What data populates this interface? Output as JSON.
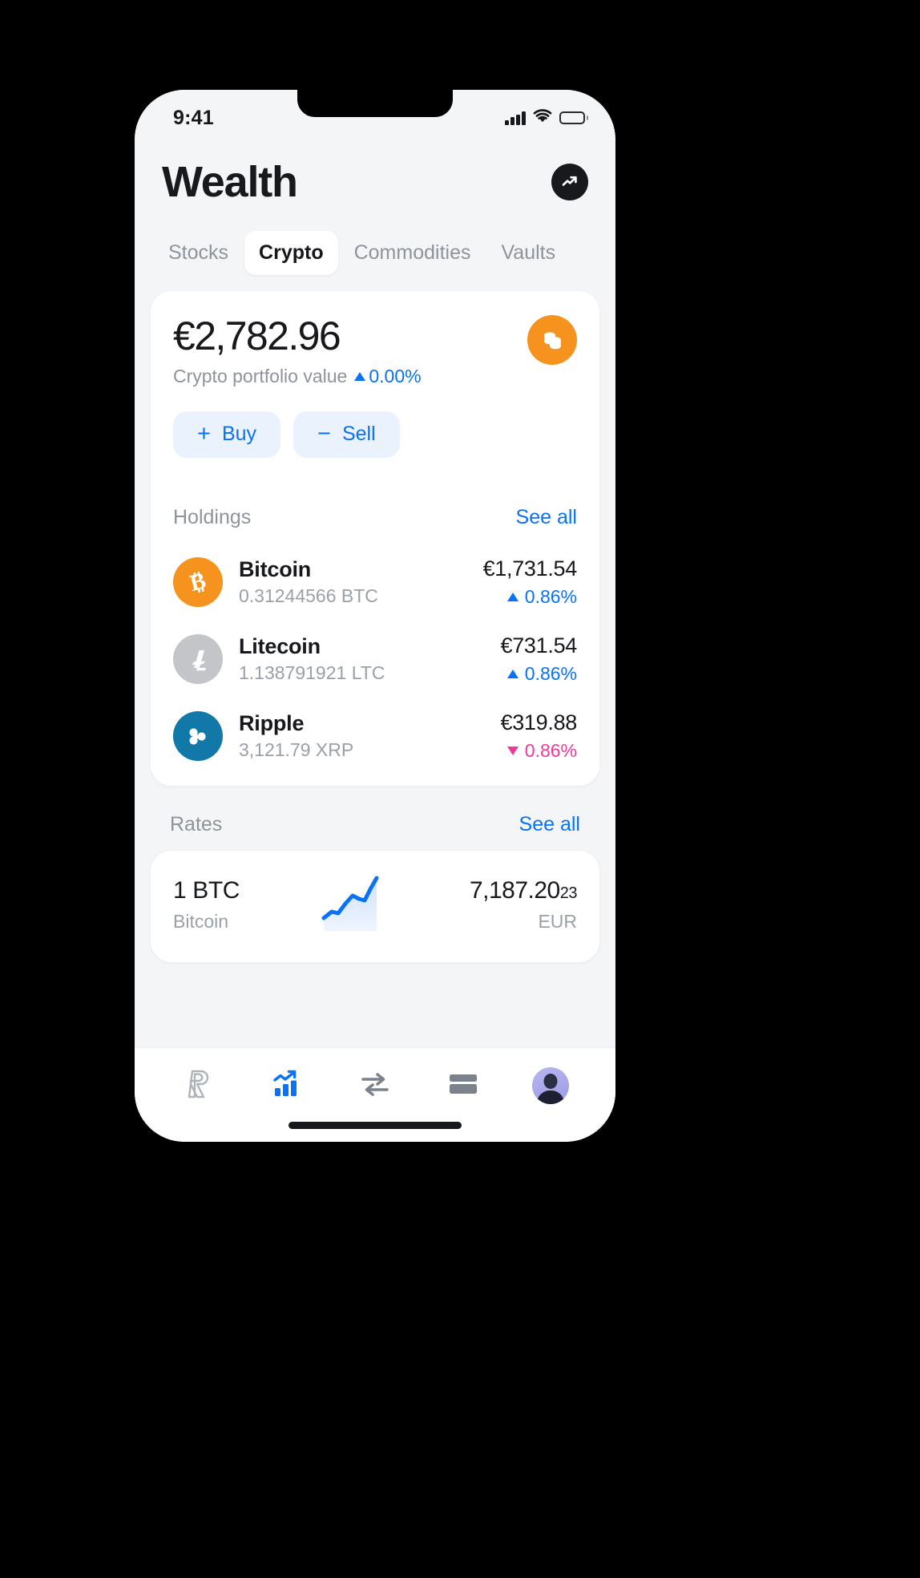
{
  "status_bar": {
    "time": "9:41",
    "signal_icon": "signal-bars-icon",
    "wifi_icon": "wifi-icon",
    "battery_icon": "battery-full-icon"
  },
  "header": {
    "title": "Wealth",
    "action_icon": "trending-up-icon"
  },
  "tabs": [
    {
      "label": "Stocks",
      "active": false
    },
    {
      "label": "Crypto",
      "active": true
    },
    {
      "label": "Commodities",
      "active": false
    },
    {
      "label": "Vaults",
      "active": false
    }
  ],
  "balance_card": {
    "amount": "€2,782.96",
    "caption": "Crypto portfolio value",
    "change": "0.00%",
    "change_direction": "up",
    "badge_icon": "coins-stack-icon",
    "badge_color": "#f5931e",
    "buy_label": "Buy",
    "buy_glyph": "+",
    "sell_label": "Sell",
    "sell_glyph": "−"
  },
  "holdings_section": {
    "title": "Holdings",
    "see_all": "See all",
    "items": [
      {
        "name": "Bitcoin",
        "units": "0.31244566 BTC",
        "value": "€1,731.54",
        "change": "0.86%",
        "direction": "up",
        "icon": "bitcoin-icon",
        "color": "#f5931e"
      },
      {
        "name": "Litecoin",
        "units": "1.138791921 LTC",
        "value": "€731.54",
        "change": "0.86%",
        "direction": "up",
        "icon": "litecoin-icon",
        "color": "#c3c5c8"
      },
      {
        "name": "Ripple",
        "units": "3,121.79 XRP",
        "value": "€319.88",
        "change": "0.86%",
        "direction": "down",
        "icon": "ripple-icon",
        "color": "#1278a8"
      }
    ]
  },
  "rates_section": {
    "title": "Rates",
    "see_all": "See all",
    "item": {
      "pair": "1 BTC",
      "name": "Bitcoin",
      "price_main": "7,187.20",
      "price_frac": "23",
      "currency": "EUR",
      "sparkline_icon": "sparkline-up-icon"
    }
  },
  "bottom_nav": [
    {
      "icon": "revolut-logo-icon",
      "active": false
    },
    {
      "icon": "wealth-bar-chart-icon",
      "active": true
    },
    {
      "icon": "exchange-arrows-icon",
      "active": false
    },
    {
      "icon": "card-icon",
      "active": false
    },
    {
      "icon": "profile-avatar-icon",
      "active": false
    }
  ],
  "colors": {
    "accent_blue": "#0972f5",
    "negative_pink": "#f0399a",
    "screen_bg": "#f4f5f7",
    "card_bg": "#ffffff",
    "text_primary": "#16181c",
    "text_muted": "#8e939c"
  },
  "chart_data": {
    "type": "line",
    "title": "1 BTC / EUR sparkline",
    "x": [
      0,
      1,
      2,
      3,
      4,
      5,
      6,
      7,
      8,
      9,
      10
    ],
    "values": [
      6790,
      6820,
      6880,
      6860,
      6960,
      7010,
      6990,
      6985,
      7040,
      7120,
      7187
    ],
    "xlabel": "",
    "ylabel": "EUR",
    "grid": false,
    "legend": "none",
    "line_color": "#0972f5",
    "fill_color": "#dbe9fd"
  }
}
